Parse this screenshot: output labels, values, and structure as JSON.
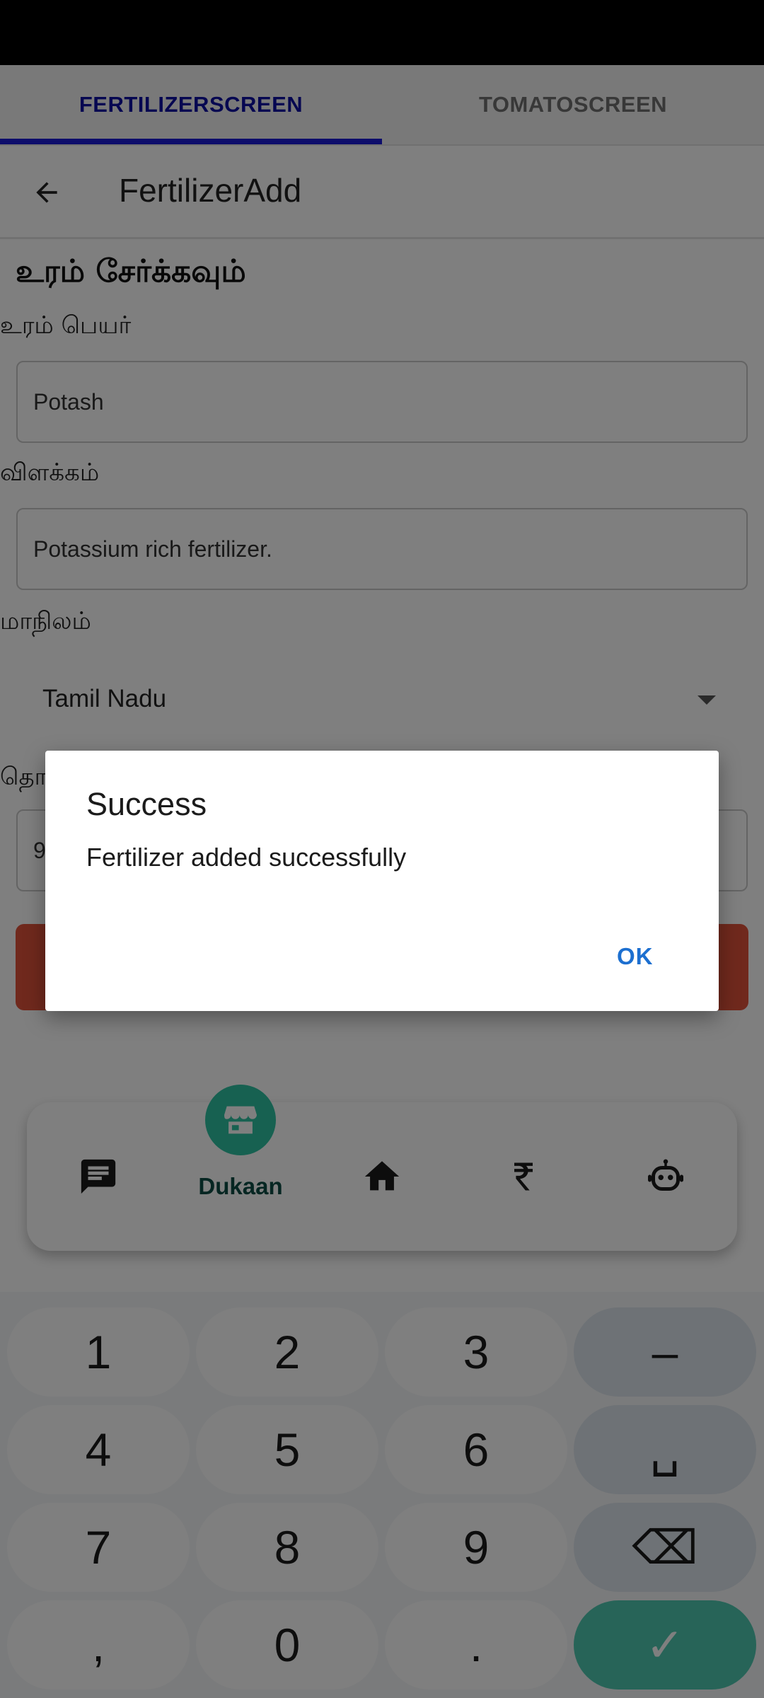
{
  "top_tabs": [
    {
      "label": "FERTILIZERSCREEN",
      "active": true
    },
    {
      "label": "TOMATOSCREEN",
      "active": false
    }
  ],
  "header": {
    "title": "FertilizerAdd"
  },
  "form": {
    "title": "உரம் சேர்க்கவும்",
    "name_label": "உரம் பெயர்",
    "name_value": "Potash",
    "description_label": "விளக்கம்",
    "description_value": "Potassium rich fertilizer.",
    "state_label": "மாநிலம்",
    "state_value": "Tamil Nadu",
    "quantity_label_partial": "தொ",
    "quantity_value_partial": "9"
  },
  "bottom_nav": {
    "active_label": "Dukaan",
    "icons": [
      "chat-icon",
      "store-icon",
      "home-icon",
      "rupee-icon",
      "robot-icon"
    ]
  },
  "keyboard": {
    "rows": [
      [
        "1",
        "2",
        "3",
        "–"
      ],
      [
        "4",
        "5",
        "6",
        "␣"
      ],
      [
        "7",
        "8",
        "9",
        "⌫"
      ],
      [
        ",",
        "0",
        ".",
        "✓"
      ]
    ]
  },
  "dialog": {
    "title": "Success",
    "message": "Fertilizer added successfully",
    "ok_label": "OK"
  },
  "colors": {
    "active_tab": "#0c0fa3",
    "tab_indicator": "#1a1ad6",
    "submit_button": "#e0533b",
    "nav_active": "#2ec2a2",
    "dialog_button": "#1c6fd0"
  }
}
